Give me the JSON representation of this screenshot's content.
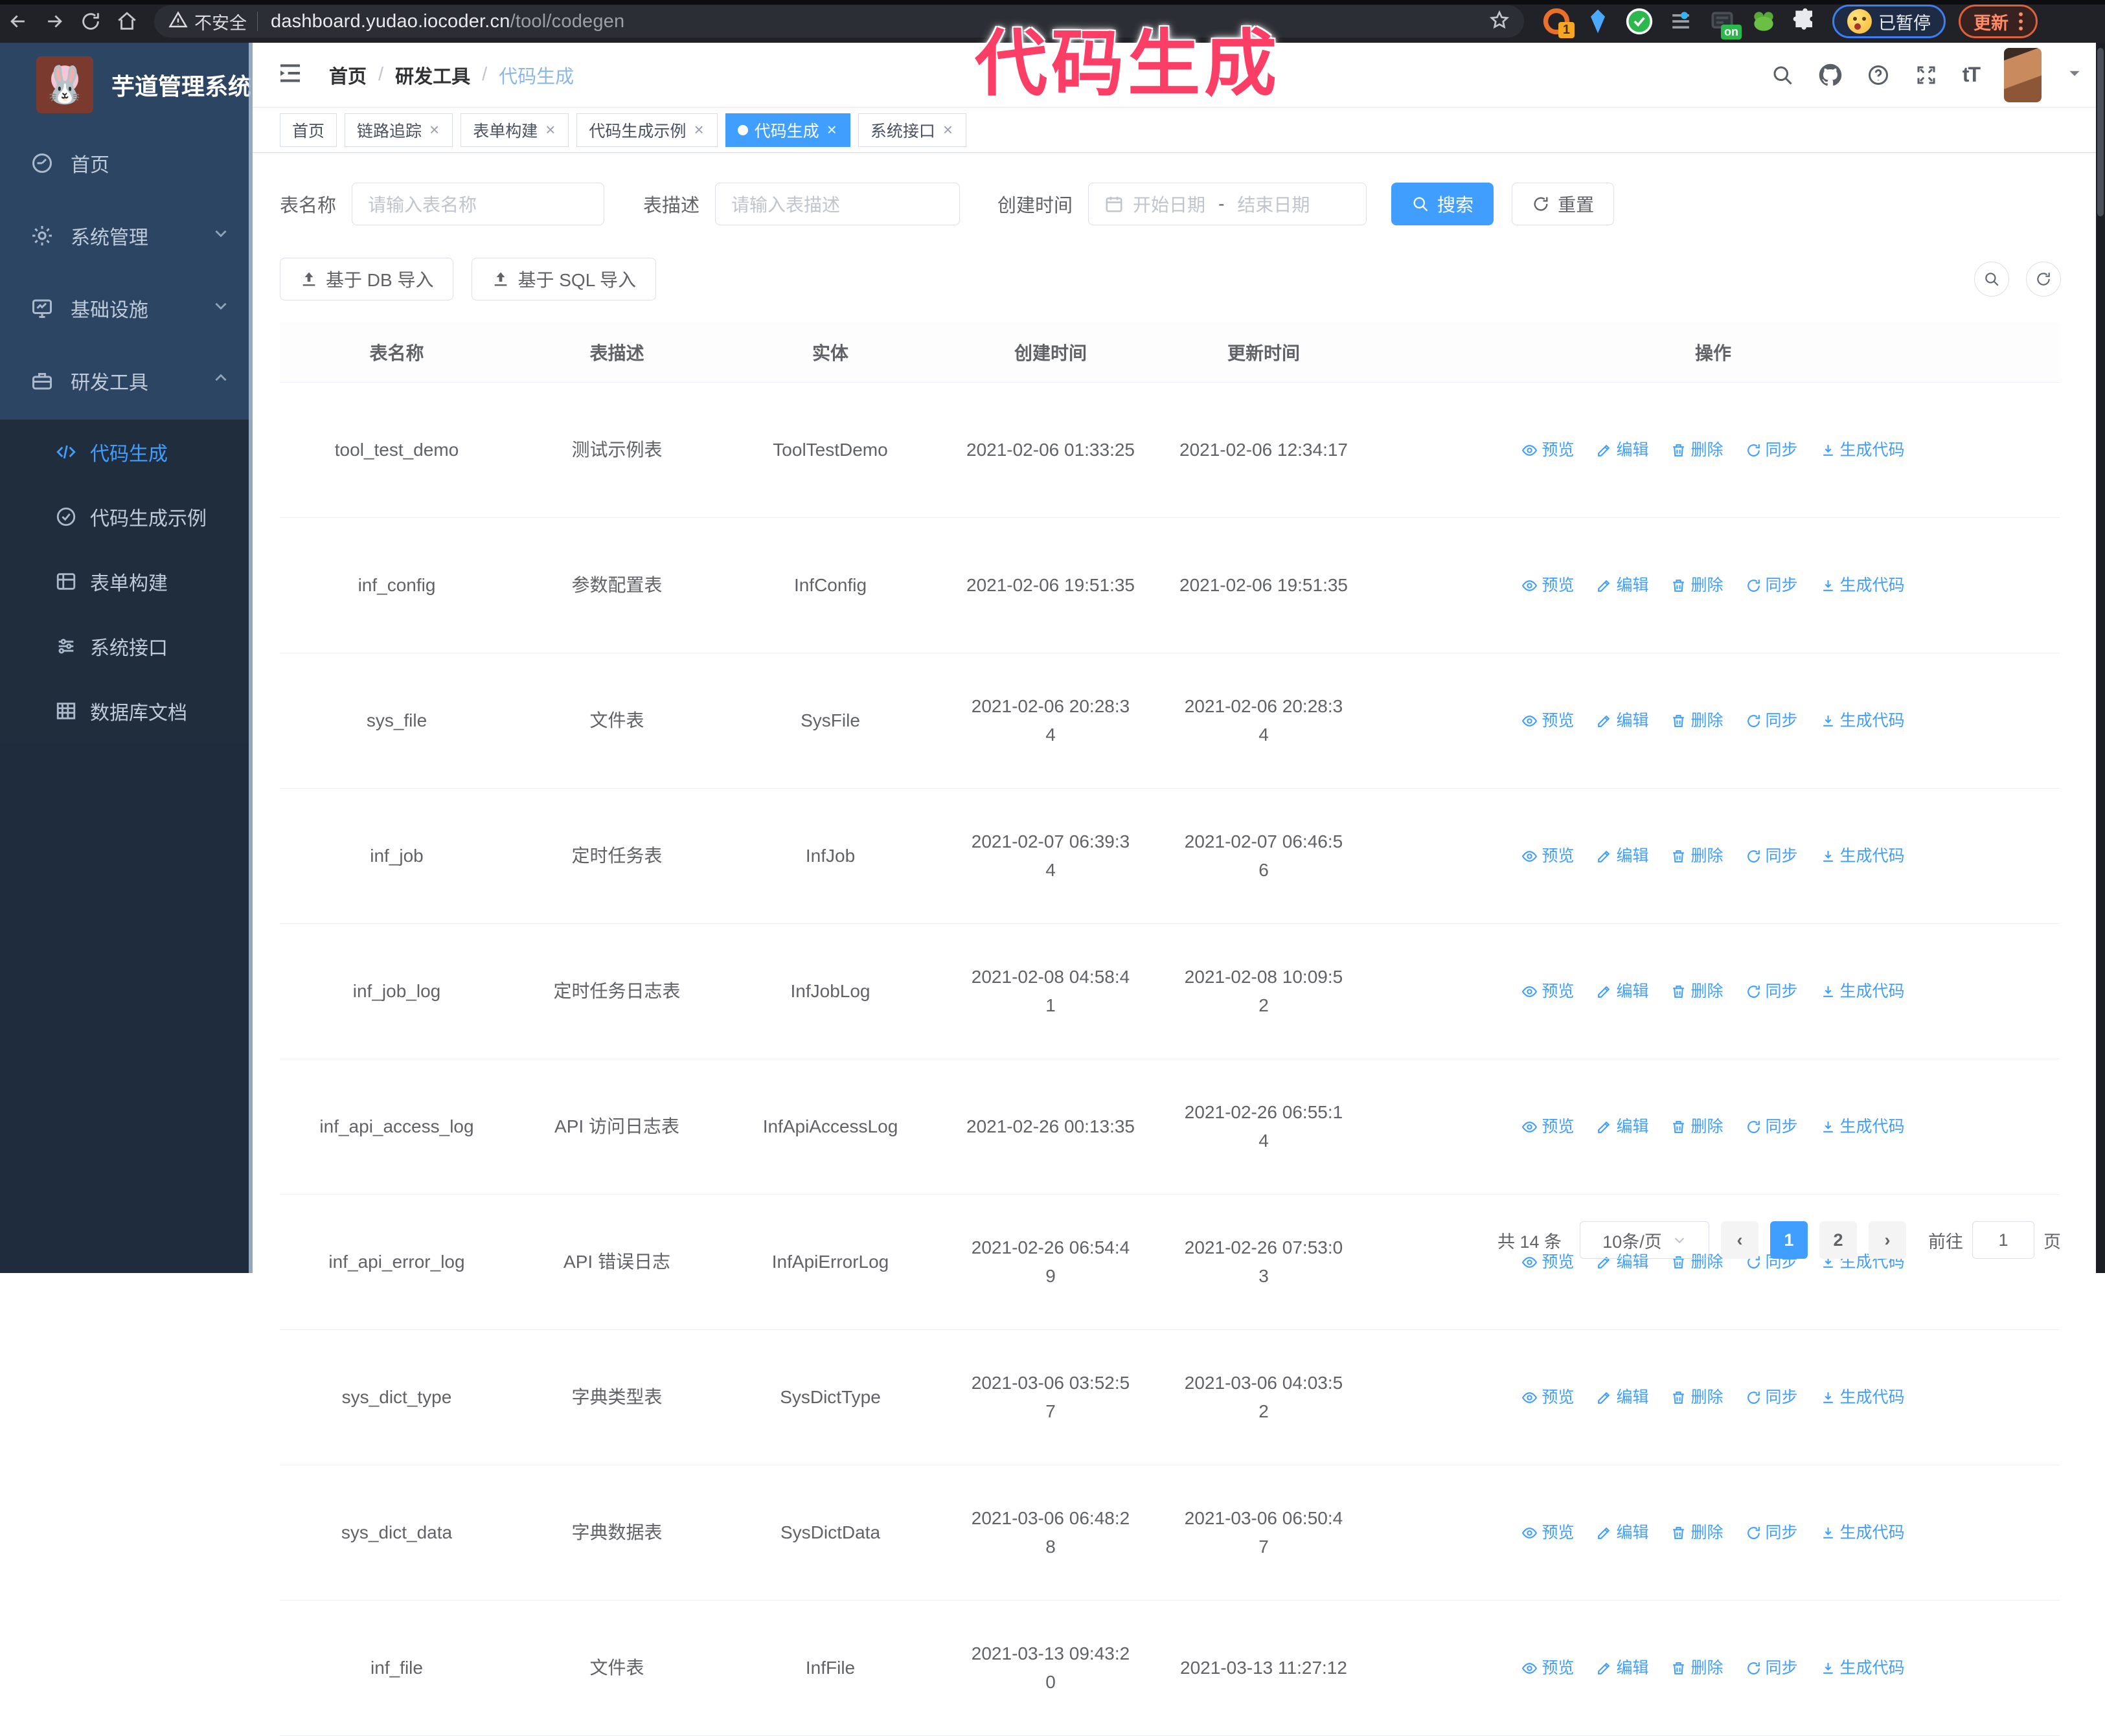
{
  "annotation": {
    "text": "代码生成"
  },
  "browser": {
    "security_label": "不安全",
    "url_host": "dashboard.yudao.iocoder.cn",
    "url_path": "/tool/codegen",
    "ext_badge_count": "1",
    "ext_on_badge": "on",
    "paused_badge": "已暂停",
    "update_button": "更新"
  },
  "sidebar": {
    "app_title": "芋道管理系统",
    "items": [
      {
        "label": "首页"
      },
      {
        "label": "系统管理"
      },
      {
        "label": "基础设施"
      },
      {
        "label": "研发工具"
      }
    ],
    "sub_items": [
      {
        "label": "代码生成"
      },
      {
        "label": "代码生成示例"
      },
      {
        "label": "表单构建"
      },
      {
        "label": "系统接口"
      },
      {
        "label": "数据库文档"
      }
    ]
  },
  "header": {
    "breadcrumb": [
      "首页",
      "研发工具",
      "代码生成"
    ]
  },
  "tags": [
    {
      "label": "首页",
      "closable": false,
      "active": false
    },
    {
      "label": "链路追踪",
      "closable": true,
      "active": false
    },
    {
      "label": "表单构建",
      "closable": true,
      "active": false
    },
    {
      "label": "代码生成示例",
      "closable": true,
      "active": false
    },
    {
      "label": "代码生成",
      "closable": true,
      "active": true
    },
    {
      "label": "系统接口",
      "closable": true,
      "active": false
    }
  ],
  "filters": {
    "name_label": "表名称",
    "name_placeholder": "请输入表名称",
    "desc_label": "表描述",
    "desc_placeholder": "请输入表描述",
    "time_label": "创建时间",
    "start_placeholder": "开始日期",
    "range_separator": "-",
    "end_placeholder": "结束日期",
    "search_label": "搜索",
    "reset_label": "重置"
  },
  "toolbar": {
    "db_import": "基于 DB 导入",
    "sql_import": "基于 SQL 导入"
  },
  "table": {
    "headers": [
      "表名称",
      "表描述",
      "实体",
      "创建时间",
      "更新时间",
      "操作"
    ],
    "actions": [
      "预览",
      "编辑",
      "删除",
      "同步",
      "生成代码"
    ],
    "rows": [
      {
        "name": "tool_test_demo",
        "desc": "测试示例表",
        "entity": "ToolTestDemo",
        "created": "2021-02-06 01:33:25",
        "updated": "2021-02-06 12:34:17"
      },
      {
        "name": "inf_config",
        "desc": "参数配置表",
        "entity": "InfConfig",
        "created": "2021-02-06 19:51:35",
        "updated": "2021-02-06 19:51:35"
      },
      {
        "name": "sys_file",
        "desc": "文件表",
        "entity": "SysFile",
        "created": "2021-02-06 20:28:3\n4",
        "updated": "2021-02-06 20:28:3\n4"
      },
      {
        "name": "inf_job",
        "desc": "定时任务表",
        "entity": "InfJob",
        "created": "2021-02-07 06:39:3\n4",
        "updated": "2021-02-07 06:46:5\n6"
      },
      {
        "name": "inf_job_log",
        "desc": "定时任务日志表",
        "entity": "InfJobLog",
        "created": "2021-02-08 04:58:4\n1",
        "updated": "2021-02-08 10:09:5\n2"
      },
      {
        "name": "inf_api_access_log",
        "desc": "API 访问日志表",
        "entity": "InfApiAccessLog",
        "created": "2021-02-26 00:13:35",
        "updated": "2021-02-26 06:55:1\n4"
      },
      {
        "name": "inf_api_error_log",
        "desc": "API 错误日志",
        "entity": "InfApiErrorLog",
        "created": "2021-02-26 06:54:4\n9",
        "updated": "2021-02-26 07:53:0\n3"
      },
      {
        "name": "sys_dict_type",
        "desc": "字典类型表",
        "entity": "SysDictType",
        "created": "2021-03-06 03:52:5\n7",
        "updated": "2021-03-06 04:03:5\n2"
      },
      {
        "name": "sys_dict_data",
        "desc": "字典数据表",
        "entity": "SysDictData",
        "created": "2021-03-06 06:48:2\n8",
        "updated": "2021-03-06 06:50:4\n7"
      },
      {
        "name": "inf_file",
        "desc": "文件表",
        "entity": "InfFile",
        "created": "2021-03-13 09:43:2\n0",
        "updated": "2021-03-13 11:27:12"
      }
    ]
  },
  "pagination": {
    "total": "共 14 条",
    "page_size": "10条/页",
    "pages": [
      "1",
      "2"
    ],
    "active_page": "1",
    "goto_label": "前往",
    "goto_value": "1",
    "page_unit": "页"
  },
  "icons": {
    "close": "×",
    "prev": "‹",
    "next": "›"
  },
  "colors": {
    "accent": "#409eff",
    "annotation_pink": "#fb3e66",
    "sidebar_bg": "#2c4563",
    "submenu_bg": "#1f2d3d"
  }
}
